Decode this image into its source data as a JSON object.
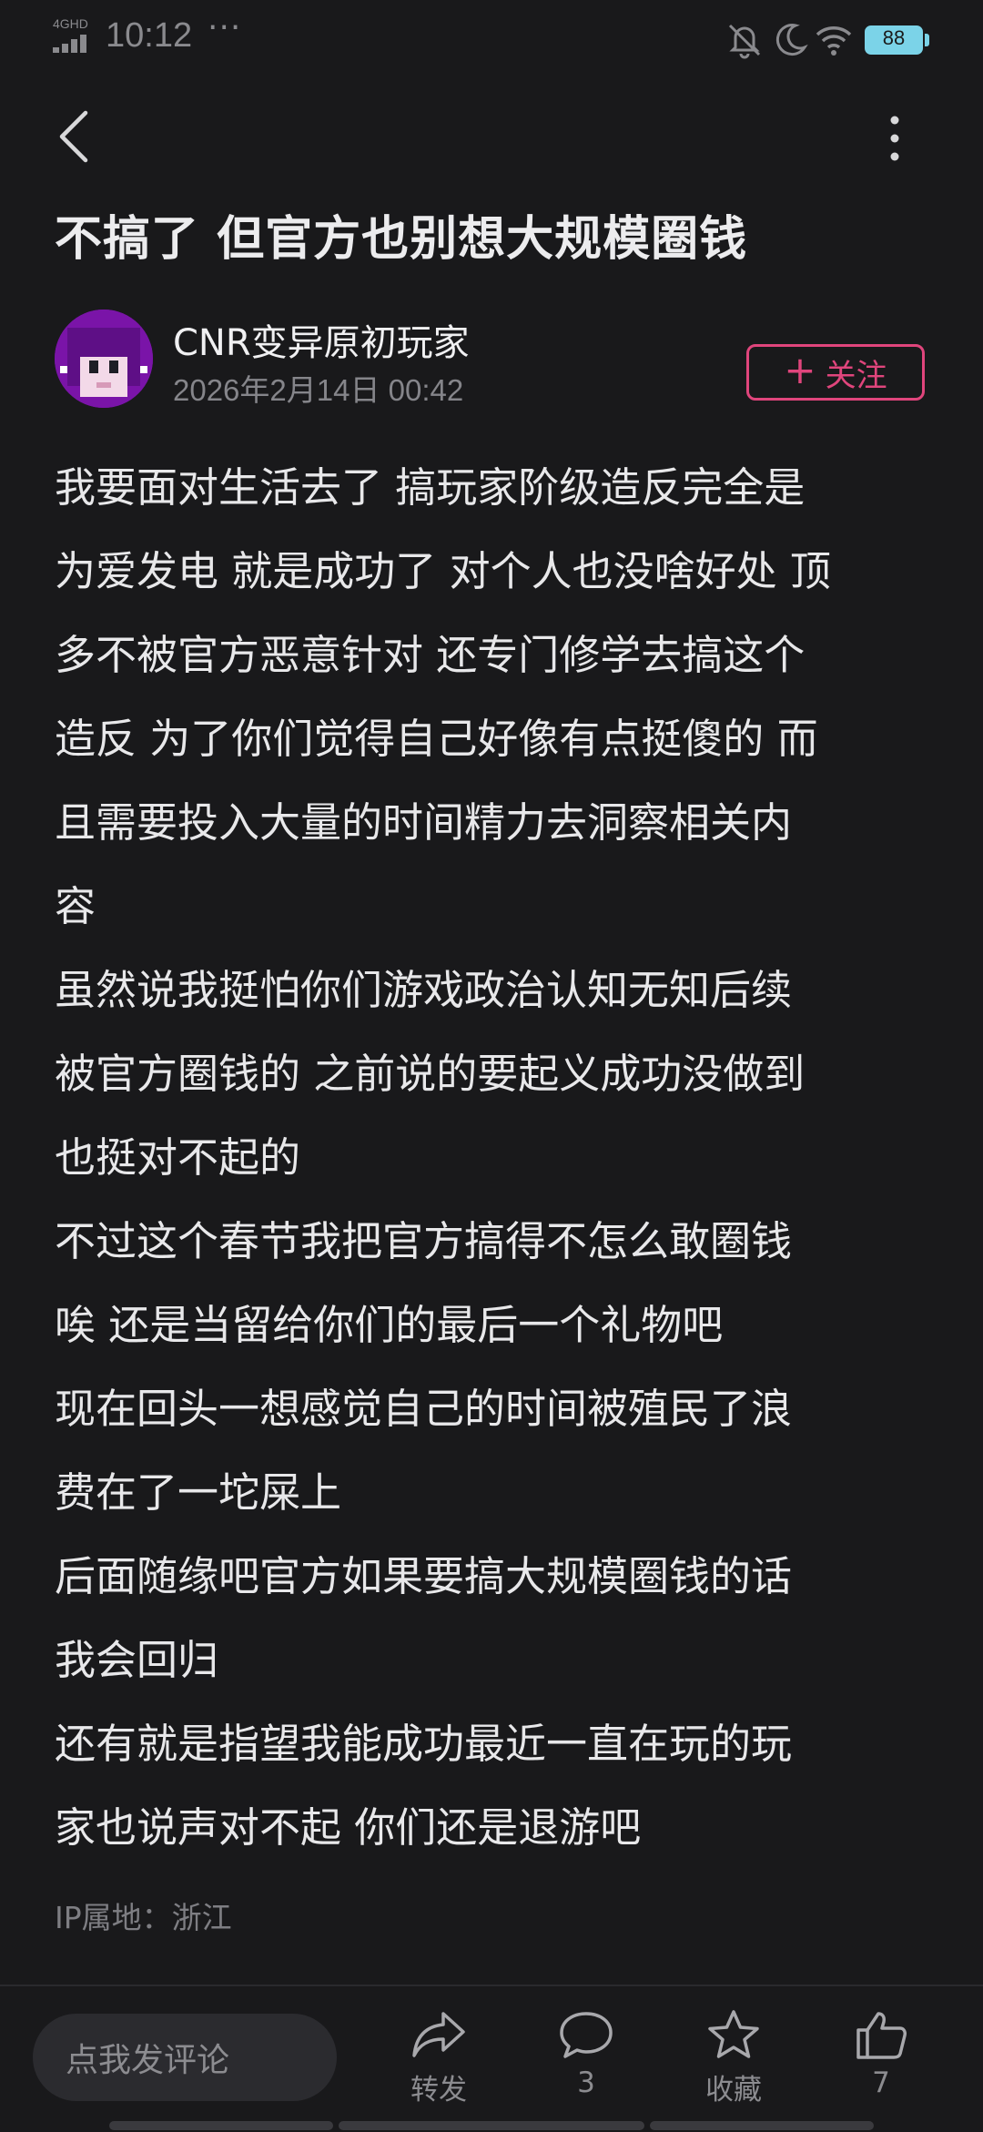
{
  "status_bar": {
    "network": "4GHD",
    "time": "10:12",
    "more": "···",
    "battery": "88",
    "colors": {
      "battery": "#7bd3e8",
      "icons": "#8a8a8e"
    }
  },
  "post": {
    "title": "不搞了 但官方也别想大规模圈钱",
    "author": {
      "name": "CNR变异原初玩家",
      "timestamp": "2026年2月14日 00:42",
      "follow_label": "关注"
    },
    "body_lines": [
      "我要面对生活去了 搞玩家阶级造反完全是",
      "为爱发电 就是成功了 对个人也没啥好处 顶",
      "多不被官方恶意针对 还专门修学去搞这个",
      "造反 为了你们觉得自己好像有点挺傻的 而",
      "且需要投入大量的时间精力去洞察相关内",
      "容",
      "虽然说我挺怕你们游戏政治认知无知后续",
      "被官方圈钱的 之前说的要起义成功没做到",
      "也挺对不起的",
      "不过这个春节我把官方搞得不怎么敢圈钱",
      "唉 还是当留给你们的最后一个礼物吧",
      "现在回头一想感觉自己的时间被殖民了浪",
      "费在了一坨屎上",
      "后面随缘吧官方如果要搞大规模圈钱的话",
      "我会回归",
      "还有就是指望我能成功最近一直在玩的玩",
      "家也说声对不起 你们还是退游吧"
    ],
    "ip_location": "IP属地：浙江"
  },
  "bottom_bar": {
    "comment_placeholder": "点我发评论",
    "share_label": "转发",
    "comment_count": "3",
    "favorite_label": "收藏",
    "like_count": "7"
  },
  "colors": {
    "background": "#19191b",
    "accent": "#e0457c",
    "text": "#e8e8ea",
    "muted": "#85858a"
  },
  "icons": [
    "back-arrow-icon",
    "more-vertical-icon",
    "plus-icon",
    "share-icon",
    "comment-icon",
    "star-icon",
    "thumbs-up-icon"
  ]
}
